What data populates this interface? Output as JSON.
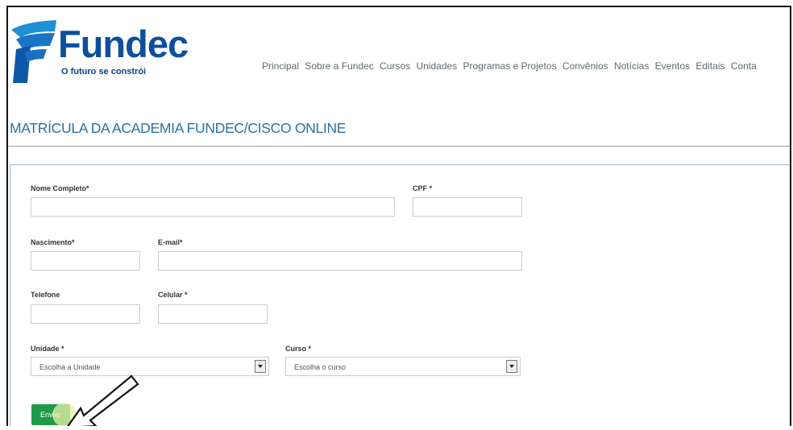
{
  "brand": {
    "name": "Fundec",
    "tagline": "O futuro se constrói"
  },
  "nav": [
    "Principal",
    "Sobre a Fundec",
    "Cursos",
    "Unidades",
    "Programas e Projetos",
    "Convênios",
    "Notícias",
    "Eventos",
    "Editais",
    "Conta"
  ],
  "page": {
    "title": "MATRÍCULA DA ACADEMIA FUNDEC/CISCO ONLINE"
  },
  "form": {
    "nome_label": "Nome Completo*",
    "cpf_label": "CPF *",
    "nascimento_label": "Nascimento*",
    "email_label": "E-mail*",
    "telefone_label": "Telefone",
    "celular_label": "Celular *",
    "unidade_label": "Unidade *",
    "unidade_value": "Escolha a Unidade",
    "curso_label": "Curso *",
    "curso_value": "Escolha o curso",
    "submit_label": "Enviar"
  },
  "colors": {
    "brand_blue": "#0d4f9e",
    "title_blue": "#2c6fa6",
    "button_green": "#1f9a48"
  }
}
